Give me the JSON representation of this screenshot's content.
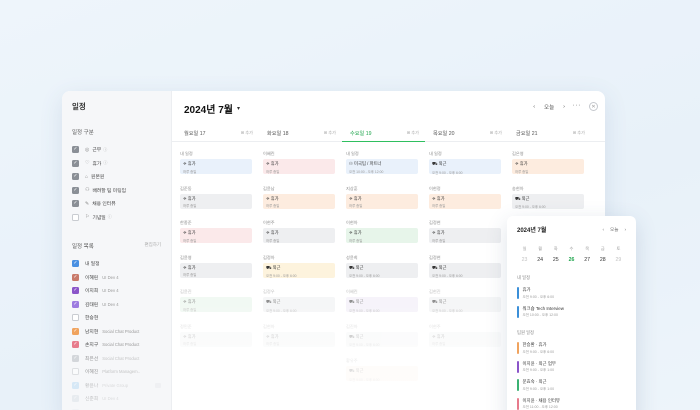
{
  "app": {
    "title": "일정"
  },
  "sidebar": {
    "category_header": "일정 구분",
    "categories": [
      {
        "icon": "◎",
        "label": "근무",
        "info": "ⓘ",
        "checked": true
      },
      {
        "icon": "♡",
        "label": "휴가",
        "info": "ⓘ",
        "checked": true
      },
      {
        "icon": "⌂",
        "label": "원본원",
        "info": "",
        "checked": true
      },
      {
        "icon": "⚇",
        "label": "배려할 팀 미팅임",
        "info": "",
        "checked": true
      },
      {
        "icon": "✎",
        "label": "채용 인터뷰",
        "info": "",
        "checked": true
      },
      {
        "icon": "⚐",
        "label": "기념일",
        "info": "ⓘ",
        "checked": false
      }
    ],
    "members_header": "일정 목록",
    "members_more": "편집하기",
    "members": [
      {
        "name": "내 일정",
        "sub": "",
        "color": "#4a90e2"
      },
      {
        "name": "이혜린",
        "sub": "UI Dev 4",
        "color": "#c97a6a"
      },
      {
        "name": "이지희",
        "sub": "UI Dev 4",
        "color": "#8b55c9"
      },
      {
        "name": "김태린",
        "sub": "UI Dev 4",
        "color": "#9d7be0"
      },
      {
        "name": "한승현",
        "sub": "",
        "color": "#ffffff"
      },
      {
        "name": "남지현",
        "sub": "Social Chat Product",
        "color": "#f0a35e"
      },
      {
        "name": "손지구",
        "sub": "Social Chat Product",
        "color": "#e77b8c"
      },
      {
        "name": "최은선",
        "sub": "Social Chat Product",
        "color": "#b8bcc2"
      },
      {
        "name": "이혜진",
        "sub": "Platform Managem..",
        "color": "#ffffff"
      },
      {
        "name": "황윤나",
        "sub": "Private Group",
        "color": "#8fc7f0"
      },
      {
        "name": "신준희",
        "sub": "UI Dev 4",
        "color": "#c6d0da"
      },
      {
        "name": "김예진",
        "sub": "Platform Managem..",
        "color": "#d0d6dc"
      }
    ]
  },
  "header": {
    "month": "2024년 7월",
    "caret": "▾",
    "prev": "‹",
    "today": "오늘",
    "next": "›",
    "more": "···",
    "close": "✕"
  },
  "days": [
    {
      "label": "월요일 17",
      "add": "⊞ 추가",
      "today": false
    },
    {
      "label": "화요일 18",
      "add": "⊞ 추가",
      "today": false
    },
    {
      "label": "수요일 19",
      "add": "⊞ 추가",
      "today": true
    },
    {
      "label": "목요일 20",
      "add": "⊞ 추가",
      "today": false
    },
    {
      "label": "금요일 21",
      "add": "⊞ 추가",
      "today": false
    }
  ],
  "entries": [
    [
      {
        "who": "내 일정",
        "title": "✈ 휴가",
        "time": "하루 종일",
        "color": "blue"
      },
      {
        "who": "김준동",
        "title": "✈ 휴가",
        "time": "하루 종일",
        "color": "gray"
      },
      {
        "who": "한종준",
        "title": "✈ 휴가",
        "time": "하루 종일",
        "color": "pink"
      },
      {
        "who": "김윤영",
        "title": "✈ 휴가",
        "time": "하루 종일",
        "color": "gray"
      },
      {
        "who": "김윤진",
        "title": "✈ 휴가",
        "time": "하루 종일",
        "color": "green"
      },
      {
        "who": "정민준",
        "title": "✈ 휴가",
        "time": "하루 종일",
        "color": "gray"
      }
    ],
    [
      {
        "who": "이혜린",
        "title": "✈ 휴가",
        "time": "하루 종일",
        "color": "pink"
      },
      {
        "who": "김윤남",
        "title": "✈ 휴가",
        "time": "하루 종일",
        "color": "orange"
      },
      {
        "who": "이현주",
        "title": "✈ 휴가",
        "time": "하루 종일",
        "color": "gray"
      },
      {
        "who": "김정아",
        "title": "⛟ 외근",
        "time": "오전 9:00 - 오후 6:00",
        "color": "yellow"
      },
      {
        "who": "김정우",
        "title": "⛟ 외근",
        "time": "오전 9:00 - 오후 6:00",
        "color": "gray"
      },
      {
        "who": "김현아",
        "title": "✈ 휴가",
        "time": "하루 종일",
        "color": "gray"
      }
    ],
    [
      {
        "who": "내 일정",
        "title": "⚇ 미국팀 / 파트너",
        "time": "오전 10:00 - 오후 12:00",
        "color": "blue"
      },
      {
        "who": "지상훈",
        "title": "✈ 휴가",
        "time": "하루 종일",
        "color": "orange"
      },
      {
        "who": "이현아",
        "title": "✈ 휴가",
        "time": "하루 종일",
        "color": "green"
      },
      {
        "who": "성윤희",
        "title": "⛟ 외근",
        "time": "오전 9:00 - 오후 6:00",
        "color": "gray"
      },
      {
        "who": "이혜린",
        "title": "⛟ 외근",
        "time": "오전 9:00 - 오후 6:00",
        "color": "purple"
      },
      {
        "who": "김진아",
        "title": "⛟ 외근",
        "time": "오전 9:00 - 오후 6:00",
        "color": "gray"
      },
      {
        "who": "황유주",
        "title": "⛟ 외근",
        "time": "오전 9:00 - 오후 6:00",
        "color": "orange"
      }
    ],
    [
      {
        "who": "내 일정",
        "title": "⛟ 외근",
        "time": "오전 9:00 - 오후 6:00",
        "color": "blue"
      },
      {
        "who": "이현정",
        "title": "✈ 휴가",
        "time": "하루 종일",
        "color": "orange"
      },
      {
        "who": "김정현",
        "title": "✈ 휴가",
        "time": "하루 종일",
        "color": "gray"
      },
      {
        "who": "김정현",
        "title": "⛟ 외근",
        "time": "오전 9:00 - 오후 6:00",
        "color": "gray"
      },
      {
        "who": "김현진",
        "title": "⛟ 외근",
        "time": "오전 9:00 - 오후 6:00",
        "color": "gray"
      },
      {
        "who": "이현주",
        "title": "✈ 휴가",
        "time": "하루 종일",
        "color": "gray"
      }
    ],
    [
      {
        "who": "김은영",
        "title": "✈ 휴가",
        "time": "하루 종일",
        "color": "orange"
      },
      {
        "who": "송현아",
        "title": "⛟ 외근",
        "time": "오전 9:00 - 오후 6:00",
        "color": "gray"
      }
    ]
  ],
  "mini_calendar": {
    "title": "2024년 7월",
    "prev": "‹",
    "today": "오늘",
    "next": "›",
    "weekdays": [
      "일",
      "월",
      "화",
      "수",
      "목",
      "금",
      "토"
    ],
    "dates": [
      {
        "d": "23",
        "state": "dim"
      },
      {
        "d": "24",
        "state": ""
      },
      {
        "d": "25",
        "state": ""
      },
      {
        "d": "26",
        "state": "sel"
      },
      {
        "d": "27",
        "state": ""
      },
      {
        "d": "28",
        "state": ""
      },
      {
        "d": "29",
        "state": "dim"
      }
    ],
    "my_section": "내 일정",
    "my_events": [
      {
        "title": "휴가",
        "time": "오전 9:00 - 오후 6:00",
        "color": "#3b8fd8"
      },
      {
        "title": "워크숍 Tech Interview",
        "time": "오전 10:00 - 오후 12:00",
        "color": "#3b8fd8"
      }
    ],
    "team_section": "팀원 일정",
    "team_events": [
      {
        "title": "한승환 · 휴가",
        "time": "오전 9:00 - 오후 6:00",
        "color": "#f0a35e"
      },
      {
        "title": "이지윤 · 외근 업무",
        "time": "오전 9:00 - 오후 1:00",
        "color": "#8b55c9"
      },
      {
        "title": "문효숙 · 외근",
        "time": "오전 9:00 - 오후 1:00",
        "color": "#3bb273"
      },
      {
        "title": "이지윤 · 채용 인터뷰",
        "time": "오전 11:00 - 오후 12:00",
        "color": "#e77b8c"
      }
    ]
  }
}
